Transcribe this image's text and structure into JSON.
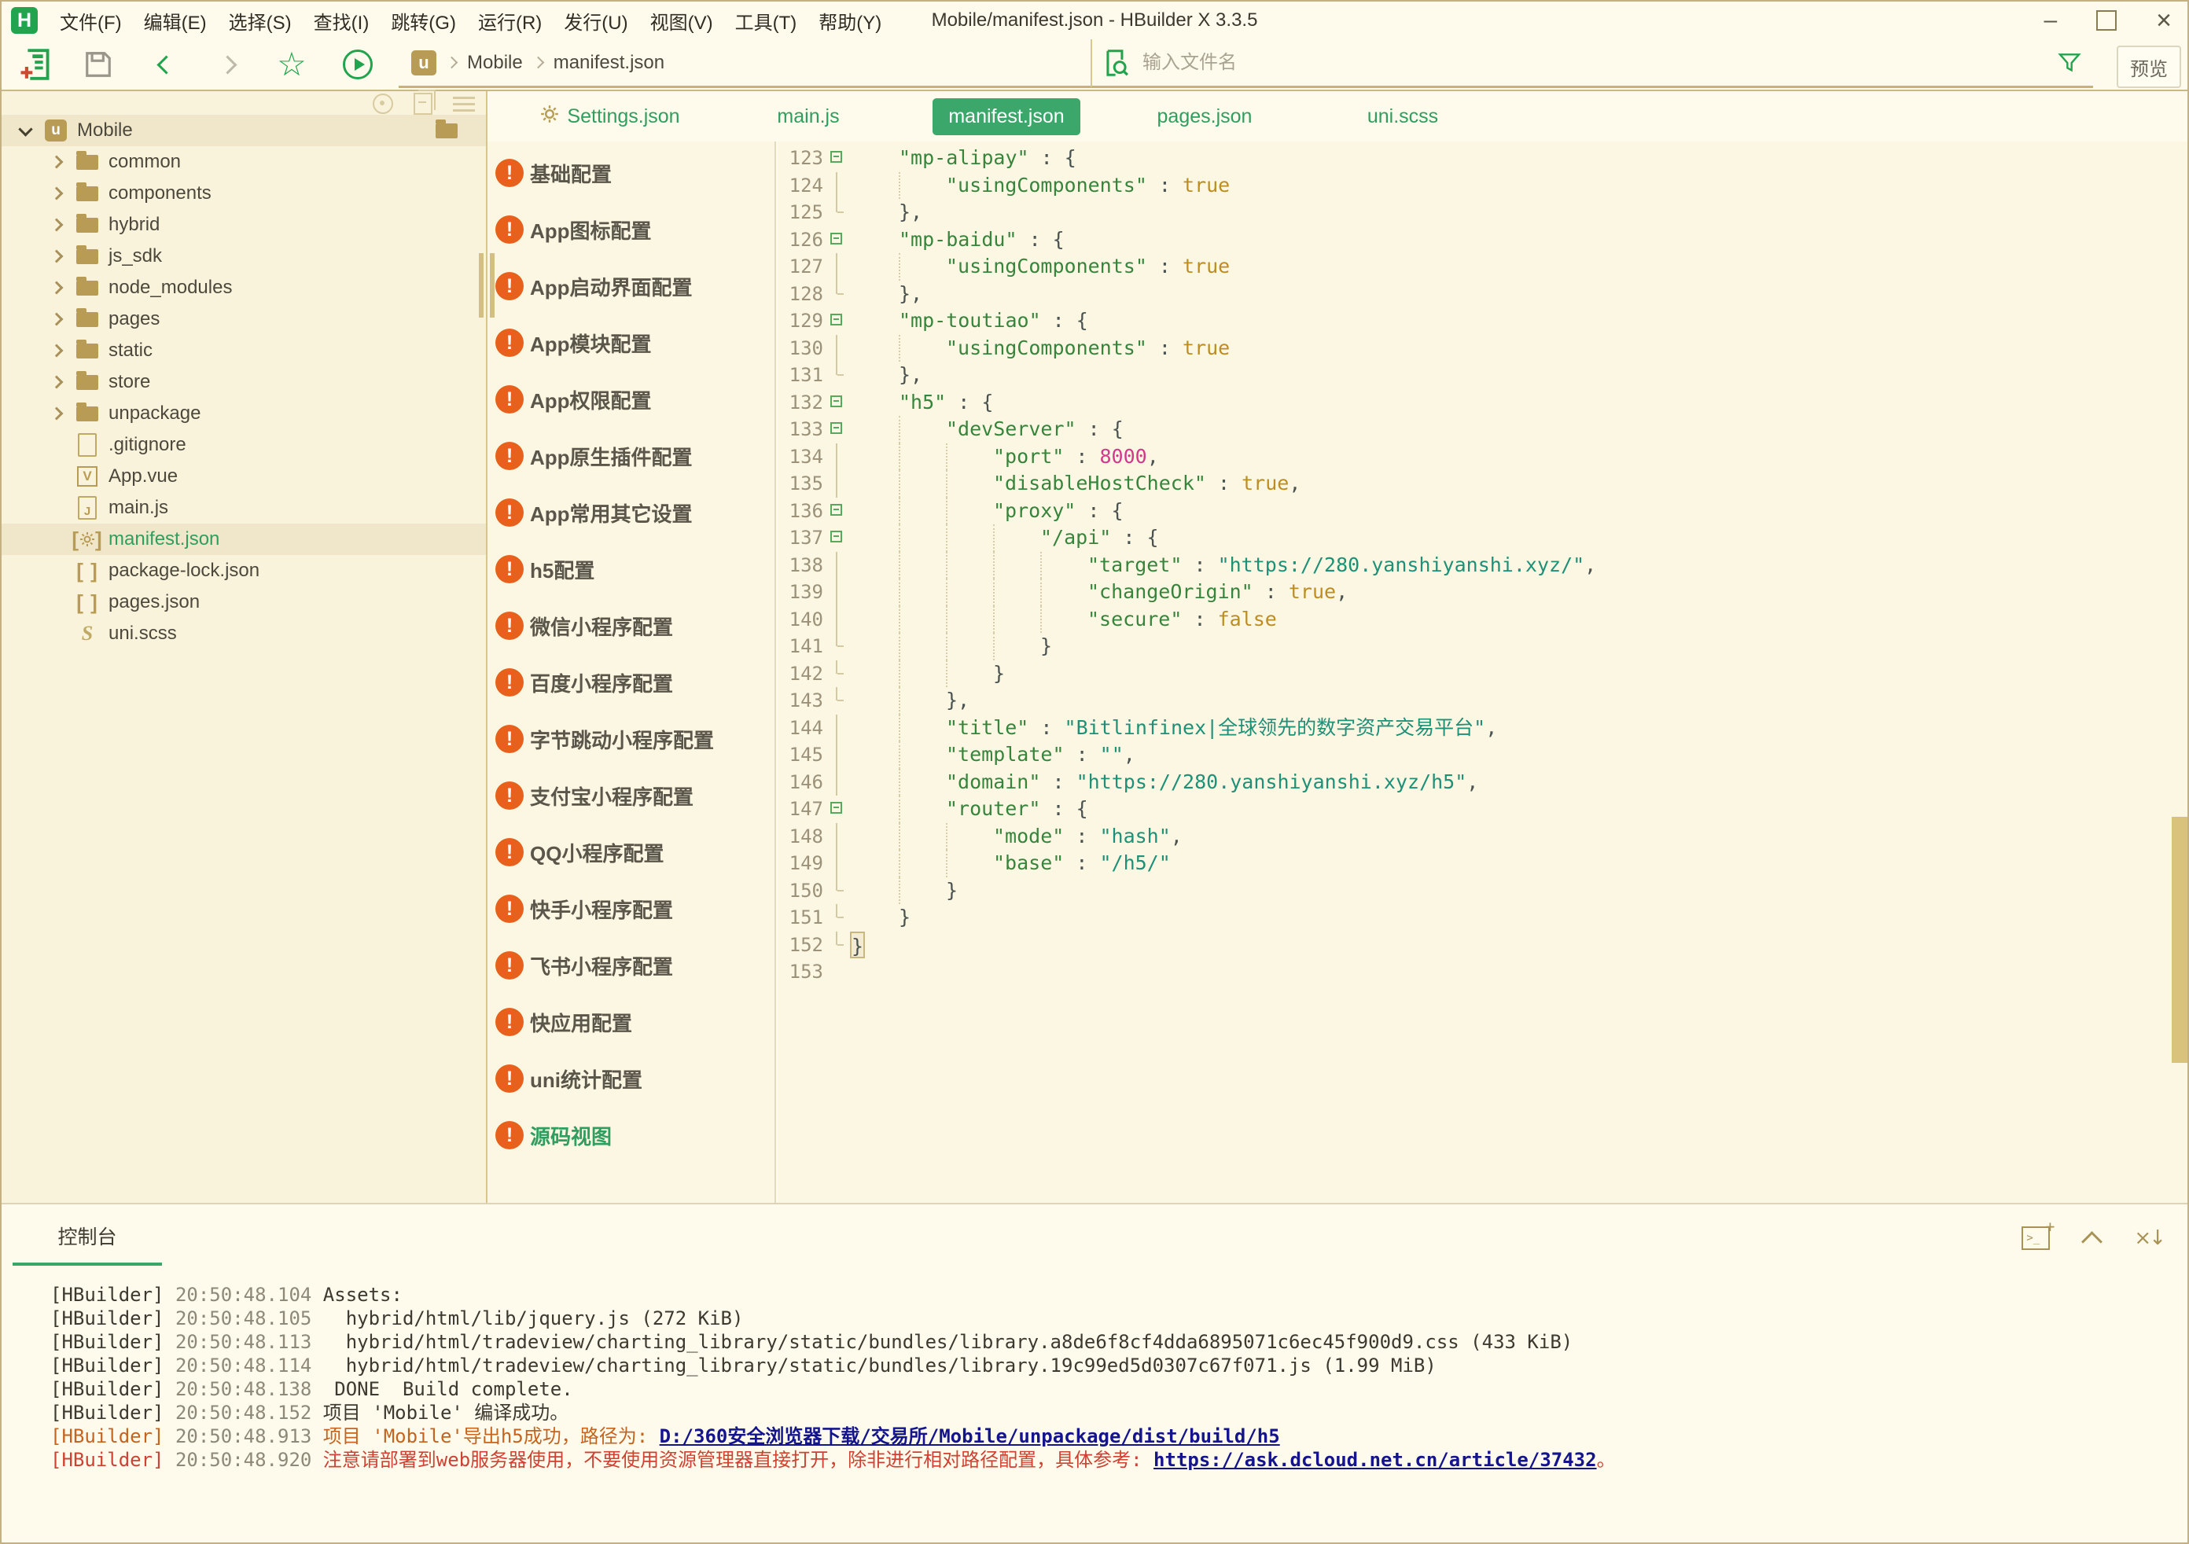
{
  "window": {
    "title": "Mobile/manifest.json - HBuilder X 3.3.5",
    "logo": "H",
    "controls": [
      "minimize",
      "maximize",
      "close"
    ]
  },
  "menu": {
    "items": [
      "文件(F)",
      "编辑(E)",
      "选择(S)",
      "查找(I)",
      "跳转(G)",
      "运行(R)",
      "发行(U)",
      "视图(V)",
      "工具(T)",
      "帮助(Y)"
    ]
  },
  "toolbar": {
    "icons": [
      "new-file",
      "save",
      "back",
      "forward",
      "star",
      "run"
    ],
    "breadcrumb": {
      "badge": "u",
      "items": [
        "Mobile",
        "manifest.json"
      ]
    },
    "search": {
      "placeholder": "输入文件名"
    },
    "preview_label": "预览"
  },
  "file_tree": {
    "header_icons": [
      "locate",
      "collapse-all",
      "menu"
    ],
    "root": {
      "label": "Mobile",
      "badge": "u"
    },
    "items": [
      {
        "type": "folder",
        "icon": "folder",
        "label": "common"
      },
      {
        "type": "folder",
        "icon": "folder",
        "label": "components"
      },
      {
        "type": "folder",
        "icon": "folder",
        "label": "hybrid"
      },
      {
        "type": "folder",
        "icon": "folder",
        "label": "js_sdk"
      },
      {
        "type": "folder",
        "icon": "folder",
        "label": "node_modules"
      },
      {
        "type": "folder",
        "icon": "folder",
        "label": "pages"
      },
      {
        "type": "folder",
        "icon": "folder",
        "label": "static"
      },
      {
        "type": "folder",
        "icon": "folder",
        "label": "store"
      },
      {
        "type": "folder",
        "icon": "folder",
        "label": "unpackage"
      },
      {
        "type": "file",
        "icon": "file",
        "label": ".gitignore"
      },
      {
        "type": "file",
        "icon": "vue",
        "label": "App.vue"
      },
      {
        "type": "file",
        "icon": "js",
        "label": "main.js"
      },
      {
        "type": "file",
        "icon": "gear-brackets",
        "label": "manifest.json",
        "selected": true
      },
      {
        "type": "file",
        "icon": "brackets",
        "label": "package-lock.json"
      },
      {
        "type": "file",
        "icon": "brackets",
        "label": "pages.json"
      },
      {
        "type": "file",
        "icon": "scss",
        "label": "uni.scss"
      }
    ]
  },
  "tabs": [
    {
      "label": "Settings.json",
      "icon": "gear",
      "active": false
    },
    {
      "label": "main.js",
      "active": false
    },
    {
      "label": "manifest.json",
      "active": true
    },
    {
      "label": "pages.json",
      "active": false
    },
    {
      "label": "uni.scss",
      "active": false
    }
  ],
  "config_menu": {
    "items": [
      {
        "label": "基础配置"
      },
      {
        "label": "App图标配置"
      },
      {
        "label": "App启动界面配置",
        "warning": true
      },
      {
        "label": "App模块配置"
      },
      {
        "label": "App权限配置"
      },
      {
        "label": "App原生插件配置"
      },
      {
        "label": "App常用其它设置"
      },
      {
        "label": "h5配置"
      },
      {
        "label": "微信小程序配置"
      },
      {
        "label": "百度小程序配置"
      },
      {
        "label": "字节跳动小程序配置"
      },
      {
        "label": "支付宝小程序配置"
      },
      {
        "label": "QQ小程序配置"
      },
      {
        "label": "快手小程序配置"
      },
      {
        "label": "飞书小程序配置"
      },
      {
        "label": "快应用配置"
      },
      {
        "label": "uni统计配置"
      },
      {
        "label": "源码视图",
        "active": true
      }
    ]
  },
  "editor": {
    "lines": [
      {
        "n": 123,
        "f": "m",
        "i": 1,
        "t": [
          [
            "\"mp-alipay\"",
            "k"
          ],
          [
            " : ",
            "p"
          ],
          [
            "{",
            "p"
          ]
        ]
      },
      {
        "n": 124,
        "f": "v",
        "i": 2,
        "t": [
          [
            "\"usingComponents\"",
            "k"
          ],
          [
            " : ",
            "p"
          ],
          [
            "true",
            "b"
          ]
        ]
      },
      {
        "n": 125,
        "f": "e",
        "i": 1,
        "t": [
          [
            "},",
            "p"
          ]
        ]
      },
      {
        "n": 126,
        "f": "m",
        "i": 1,
        "t": [
          [
            "\"mp-baidu\"",
            "k"
          ],
          [
            " : ",
            "p"
          ],
          [
            "{",
            "p"
          ]
        ]
      },
      {
        "n": 127,
        "f": "v",
        "i": 2,
        "t": [
          [
            "\"usingComponents\"",
            "k"
          ],
          [
            " : ",
            "p"
          ],
          [
            "true",
            "b"
          ]
        ]
      },
      {
        "n": 128,
        "f": "e",
        "i": 1,
        "t": [
          [
            "},",
            "p"
          ]
        ]
      },
      {
        "n": 129,
        "f": "m",
        "i": 1,
        "t": [
          [
            "\"mp-toutiao\"",
            "k"
          ],
          [
            " : ",
            "p"
          ],
          [
            "{",
            "p"
          ]
        ]
      },
      {
        "n": 130,
        "f": "v",
        "i": 2,
        "t": [
          [
            "\"usingComponents\"",
            "k"
          ],
          [
            " : ",
            "p"
          ],
          [
            "true",
            "b"
          ]
        ]
      },
      {
        "n": 131,
        "f": "e",
        "i": 1,
        "t": [
          [
            "},",
            "p"
          ]
        ]
      },
      {
        "n": 132,
        "f": "m",
        "i": 1,
        "t": [
          [
            "\"h5\"",
            "k"
          ],
          [
            " : ",
            "p"
          ],
          [
            "{",
            "p"
          ]
        ]
      },
      {
        "n": 133,
        "f": "m",
        "i": 2,
        "t": [
          [
            "\"devServer\"",
            "k"
          ],
          [
            " : ",
            "p"
          ],
          [
            "{",
            "p"
          ]
        ]
      },
      {
        "n": 134,
        "f": "v",
        "i": 3,
        "t": [
          [
            "\"port\"",
            "k"
          ],
          [
            " : ",
            "p"
          ],
          [
            "8000",
            "n"
          ],
          [
            ",",
            "p"
          ]
        ]
      },
      {
        "n": 135,
        "f": "v",
        "i": 3,
        "t": [
          [
            "\"disableHostCheck\"",
            "k"
          ],
          [
            " : ",
            "p"
          ],
          [
            "true",
            "b"
          ],
          [
            ",",
            "p"
          ]
        ]
      },
      {
        "n": 136,
        "f": "m",
        "i": 3,
        "t": [
          [
            "\"proxy\"",
            "k"
          ],
          [
            " : ",
            "p"
          ],
          [
            "{",
            "p"
          ]
        ]
      },
      {
        "n": 137,
        "f": "m",
        "i": 4,
        "t": [
          [
            "\"/api\"",
            "k"
          ],
          [
            " : ",
            "p"
          ],
          [
            "{",
            "p"
          ]
        ]
      },
      {
        "n": 138,
        "f": "v",
        "i": 5,
        "t": [
          [
            "\"target\"",
            "k"
          ],
          [
            " : ",
            "p"
          ],
          [
            "\"https://280.yanshiyanshi.xyz/\"",
            "s"
          ],
          [
            ",",
            "p"
          ]
        ]
      },
      {
        "n": 139,
        "f": "v",
        "i": 5,
        "t": [
          [
            "\"changeOrigin\"",
            "k"
          ],
          [
            " : ",
            "p"
          ],
          [
            "true",
            "b"
          ],
          [
            ",",
            "p"
          ]
        ]
      },
      {
        "n": 140,
        "f": "v",
        "i": 5,
        "t": [
          [
            "\"secure\"",
            "k"
          ],
          [
            " : ",
            "p"
          ],
          [
            "false",
            "b"
          ]
        ]
      },
      {
        "n": 141,
        "f": "e",
        "i": 4,
        "t": [
          [
            "}",
            "p"
          ]
        ]
      },
      {
        "n": 142,
        "f": "e",
        "i": 3,
        "t": [
          [
            "}",
            "p"
          ]
        ]
      },
      {
        "n": 143,
        "f": "e",
        "i": 2,
        "t": [
          [
            "},",
            "p"
          ]
        ]
      },
      {
        "n": 144,
        "f": "v",
        "i": 2,
        "t": [
          [
            "\"title\"",
            "k"
          ],
          [
            " : ",
            "p"
          ],
          [
            "\"Bitlinfinex|全球领先的数字资产交易平台\"",
            "s"
          ],
          [
            ",",
            "p"
          ]
        ]
      },
      {
        "n": 145,
        "f": "v",
        "i": 2,
        "t": [
          [
            "\"template\"",
            "k"
          ],
          [
            " : ",
            "p"
          ],
          [
            "\"\"",
            "s"
          ],
          [
            ",",
            "p"
          ]
        ]
      },
      {
        "n": 146,
        "f": "v",
        "i": 2,
        "t": [
          [
            "\"domain\"",
            "k"
          ],
          [
            " : ",
            "p"
          ],
          [
            "\"https://280.yanshiyanshi.xyz/h5\"",
            "s"
          ],
          [
            ",",
            "p"
          ]
        ]
      },
      {
        "n": 147,
        "f": "m",
        "i": 2,
        "t": [
          [
            "\"router\"",
            "k"
          ],
          [
            " : ",
            "p"
          ],
          [
            "{",
            "p"
          ]
        ]
      },
      {
        "n": 148,
        "f": "v",
        "i": 3,
        "t": [
          [
            "\"mode\"",
            "k"
          ],
          [
            " : ",
            "p"
          ],
          [
            "\"hash\"",
            "s"
          ],
          [
            ",",
            "p"
          ]
        ]
      },
      {
        "n": 149,
        "f": "v",
        "i": 3,
        "t": [
          [
            "\"base\"",
            "k"
          ],
          [
            " : ",
            "p"
          ],
          [
            "\"/h5/\"",
            "s"
          ]
        ]
      },
      {
        "n": 150,
        "f": "e",
        "i": 2,
        "t": [
          [
            "}",
            "p"
          ]
        ]
      },
      {
        "n": 151,
        "f": "e",
        "i": 1,
        "t": [
          [
            "}",
            "p"
          ]
        ]
      },
      {
        "n": 152,
        "f": "e",
        "i": 0,
        "t": [
          [
            "}",
            "p"
          ]
        ],
        "hl": true
      },
      {
        "n": 153,
        "f": "",
        "i": 0,
        "t": []
      }
    ]
  },
  "console": {
    "tab": "控制台",
    "icons": [
      "new-terminal",
      "collapse-panel",
      "clear"
    ],
    "lines": [
      {
        "segs": [
          [
            "[HBuilder] ",
            "d"
          ],
          [
            "20:50:48.104 ",
            "t"
          ],
          [
            "Assets:",
            "d"
          ]
        ]
      },
      {
        "segs": [
          [
            "[HBuilder] ",
            "d"
          ],
          [
            "20:50:48.105 ",
            "t"
          ],
          [
            "  hybrid/html/lib/jquery.js (272 KiB)",
            "d"
          ]
        ]
      },
      {
        "segs": [
          [
            "[HBuilder] ",
            "d"
          ],
          [
            "20:50:48.113 ",
            "t"
          ],
          [
            "  hybrid/html/tradeview/charting_library/static/bundles/library.a8de6f8cf4dda6895071c6ec45f900d9.css (433 KiB)",
            "d"
          ]
        ]
      },
      {
        "segs": [
          [
            "[HBuilder] ",
            "d"
          ],
          [
            "20:50:48.114 ",
            "t"
          ],
          [
            "  hybrid/html/tradeview/charting_library/static/bundles/library.19c99ed5d0307c67f071.js (1.99 MiB)",
            "d"
          ]
        ]
      },
      {
        "segs": [
          [
            "[HBuilder] ",
            "d"
          ],
          [
            "20:50:48.138 ",
            "t"
          ],
          [
            " DONE  Build complete.",
            "d"
          ]
        ]
      },
      {
        "segs": [
          [
            "[HBuilder] ",
            "d"
          ],
          [
            "20:50:48.152 ",
            "t"
          ],
          [
            "项目 'Mobile' 编译成功。",
            "d"
          ]
        ]
      },
      {
        "segs": [
          [
            "[HBuilder] ",
            "o"
          ],
          [
            "20:50:48.913 ",
            "t"
          ],
          [
            "项目 'Mobile'导出h5成功，路径为: ",
            "o"
          ],
          [
            "D:/360安全浏览器下载/交易所/Mobile/unpackage/dist/build/h5",
            "l"
          ]
        ]
      },
      {
        "segs": [
          [
            "[HBuilder] ",
            "r"
          ],
          [
            "20:50:48.920 ",
            "t"
          ],
          [
            "注意请部署到web服务器使用，不要使用资源管理器直接打开，除非进行相对路径配置，具体参考: ",
            "r"
          ],
          [
            "https://ask.dcloud.net.cn/article/37432",
            "l"
          ],
          [
            "。",
            "r"
          ]
        ]
      }
    ]
  },
  "colors": {
    "accent_green": "#3BA76A",
    "icon_green": "#21A44D",
    "gold": "#B89B55",
    "warning_orange": "#E8611C",
    "notice_orange": "#C4641F",
    "error_red": "#CD4232",
    "link_navy": "#14148C",
    "editor_bg": "#FCF7E3",
    "tree_bg": "#FAF3DC"
  }
}
